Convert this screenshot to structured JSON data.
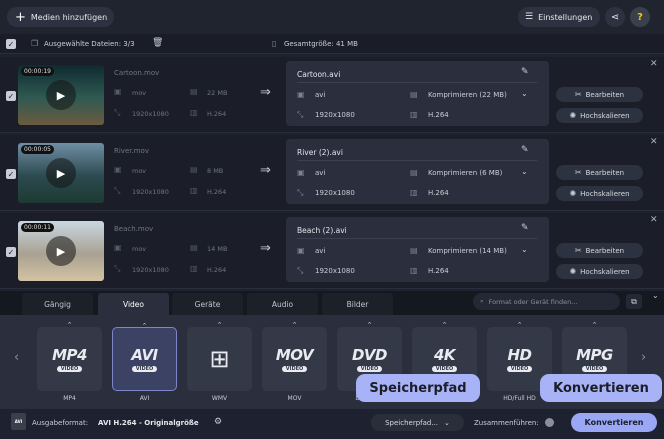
{
  "topbar": {
    "add_media_label": "Medien hinzufügen",
    "settings_label": "Einstellungen",
    "help_label": "?"
  },
  "toolbar": {
    "selected_label": "Ausgewählte Dateien: 3/3",
    "total_size_label": "Gesamtgröße: 41 MB"
  },
  "files": [
    {
      "duration": "00:00:19",
      "source_name": "Cartoon.mov",
      "source_format": "mov",
      "source_size": "22 MB",
      "source_resolution": "1920x1080",
      "source_codec": "H.264",
      "output_name": "Cartoon.avi",
      "output_format": "avi",
      "output_compress": "Komprimieren (22 MB)",
      "output_resolution": "1920x1080",
      "output_codec": "H.264",
      "thumb_colors": [
        "#0f2a30",
        "#2f5a52",
        "#6b5b3e"
      ]
    },
    {
      "duration": "00:00:05",
      "source_name": "River.mov",
      "source_format": "mov",
      "source_size": "8 MB",
      "source_resolution": "1920x1080",
      "source_codec": "H.264",
      "output_name": "River (2).avi",
      "output_format": "avi",
      "output_compress": "Komprimieren (6 MB)",
      "output_resolution": "1920x1080",
      "output_codec": "H.264",
      "thumb_colors": [
        "#6f8ea3",
        "#2c4a50",
        "#1d3a33"
      ]
    },
    {
      "duration": "00:00:11",
      "source_name": "Beach.mov",
      "source_format": "mov",
      "source_size": "14 MB",
      "source_resolution": "1920x1080",
      "source_codec": "H.264",
      "output_name": "Beach (2).avi",
      "output_format": "avi",
      "output_compress": "Komprimieren (14 MB)",
      "output_resolution": "1920x1080",
      "output_codec": "H.264",
      "thumb_colors": [
        "#c9d7e2",
        "#a9a192",
        "#d2c3a2"
      ]
    }
  ],
  "row_buttons": {
    "edit_label": "Bearbeiten",
    "upscale_label": "Hochskalieren"
  },
  "tabs": [
    "Gängig",
    "Video",
    "Geräte",
    "Audio",
    "Bilder"
  ],
  "active_tab": "Video",
  "search_placeholder": "Format oder Gerät finden...",
  "formats": [
    {
      "logo": "MP4",
      "sub": "VIDEO",
      "label": "MP4"
    },
    {
      "logo": "AVI",
      "sub": "VIDEO",
      "label": "AVI"
    },
    {
      "logo": "",
      "sub": "",
      "label": "WMV"
    },
    {
      "logo": "MOV",
      "sub": "VIDEO",
      "label": "MOV"
    },
    {
      "logo": "DVD",
      "sub": "VIDEO",
      "label": "DVD-Ko..."
    },
    {
      "logo": "4K",
      "sub": "VIDEO",
      "label": ""
    },
    {
      "logo": "HD",
      "sub": "VIDEO",
      "label": "HD/Full HD"
    },
    {
      "logo": "MPG",
      "sub": "VIDEO",
      "label": "MPG"
    }
  ],
  "bottombar": {
    "output_format_label": "Ausgabeformat:",
    "output_format_value": "AVI H.264 - Originalgröße",
    "save_path_label": "Speicherpfad...",
    "merge_label": "Zusammenführen:",
    "convert_label": "Konvertieren"
  },
  "tooltips": {
    "save_path": "Speicherpfad",
    "convert": "Konvertieren"
  },
  "colors": {
    "accent": "#9aa7f5",
    "background": "#1e2230",
    "panel": "#2b2f3d"
  }
}
